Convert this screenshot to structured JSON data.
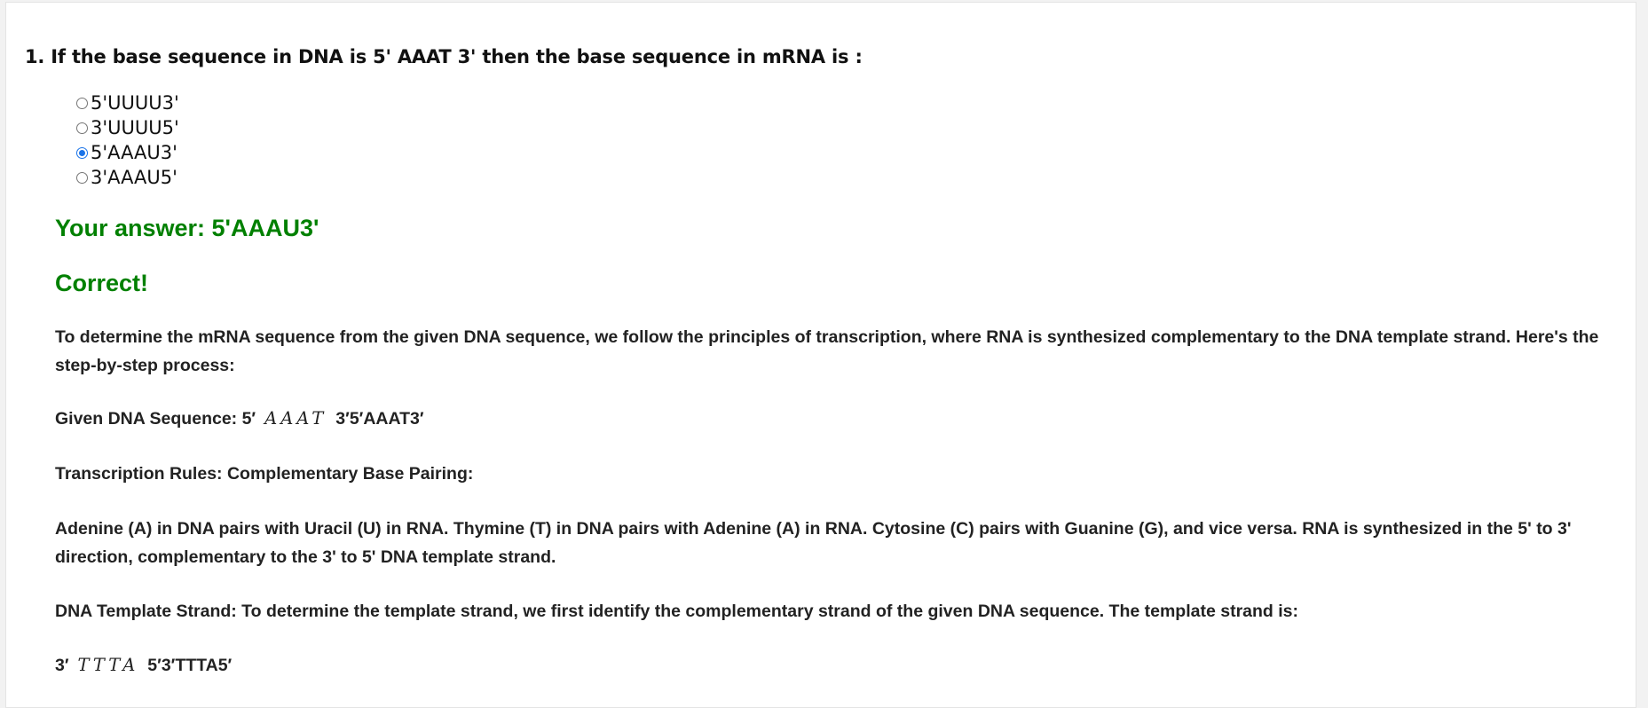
{
  "question": {
    "text": "1. If the base sequence in DNA is 5' AAAT 3' then the base sequence in mRNA is :"
  },
  "options": [
    {
      "label": "5'UUUU3'",
      "checked": false
    },
    {
      "label": "3'UUUU5'",
      "checked": false
    },
    {
      "label": "5'AAAU3'",
      "checked": true
    },
    {
      "label": "3'AAAU5'",
      "checked": false
    }
  ],
  "result": {
    "your_answer": "Your answer: 5'AAAU3'",
    "verdict": "Correct!",
    "color": "#008000"
  },
  "explanation": {
    "intro": "To determine the mRNA sequence from the given DNA sequence, we follow the principles of transcription, where RNA is synthesized complementary to the DNA template strand. Here's the step-by-step process:",
    "given_prefix": "Given DNA Sequence: 5′",
    "given_math": "AAAT",
    "given_suffix": "3′5′AAAT3′",
    "rules": "Transcription Rules: Complementary Base Pairing:",
    "rules_detail": "Adenine (A) in DNA pairs with Uracil (U) in RNA. Thymine (T) in DNA pairs with Adenine (A) in RNA. Cytosine (C) pairs with Guanine (G), and vice versa. RNA is synthesized in the 5' to 3' direction, complementary to the 3' to 5' DNA template strand.",
    "template": "DNA Template Strand: To determine the template strand, we first identify the complementary strand of the given DNA sequence. The template strand is:",
    "template_prefix": "3′",
    "template_math": "TTTA",
    "template_suffix": "5′3′TTTA5′"
  },
  "colors": {
    "radio_accent": "#1a73e8",
    "text": "#222222"
  }
}
